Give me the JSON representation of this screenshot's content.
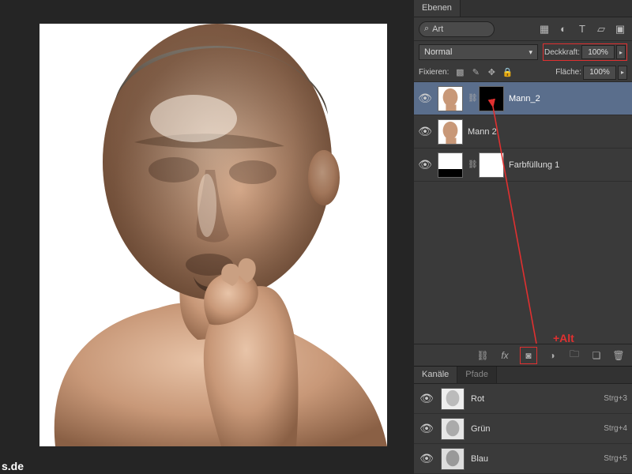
{
  "panel_tabs": {
    "layers": "Ebenen",
    "channels": "Kanäle",
    "paths": "Pfade"
  },
  "search": {
    "label": "Art",
    "icon": "search"
  },
  "filter_icons": [
    "image",
    "adjust",
    "text",
    "transform",
    "smart"
  ],
  "blend": {
    "mode": "Normal"
  },
  "opacity": {
    "label": "Deckkraft:",
    "value": "100%"
  },
  "lock": {
    "label": "Fixieren:"
  },
  "fill": {
    "label": "Fläche:",
    "value": "100%"
  },
  "layers": [
    {
      "name": "Mann_2",
      "selected": true,
      "mask": "black",
      "thumb": "portrait"
    },
    {
      "name": "Mann 2",
      "selected": false,
      "mask": null,
      "thumb": "portrait"
    },
    {
      "name": "Farbfüllung 1",
      "selected": false,
      "mask": "white",
      "thumb": "fill"
    }
  ],
  "bottom_icons": [
    "link",
    "fx",
    "mask",
    "adjust",
    "group",
    "new",
    "trash"
  ],
  "channels": [
    {
      "name": "Rot",
      "shortcut": "Strg+3"
    },
    {
      "name": "Grün",
      "shortcut": "Strg+4"
    },
    {
      "name": "Blau",
      "shortcut": "Strg+5"
    }
  ],
  "annotation": {
    "alt_text": "+Alt"
  },
  "watermark": "s.de"
}
